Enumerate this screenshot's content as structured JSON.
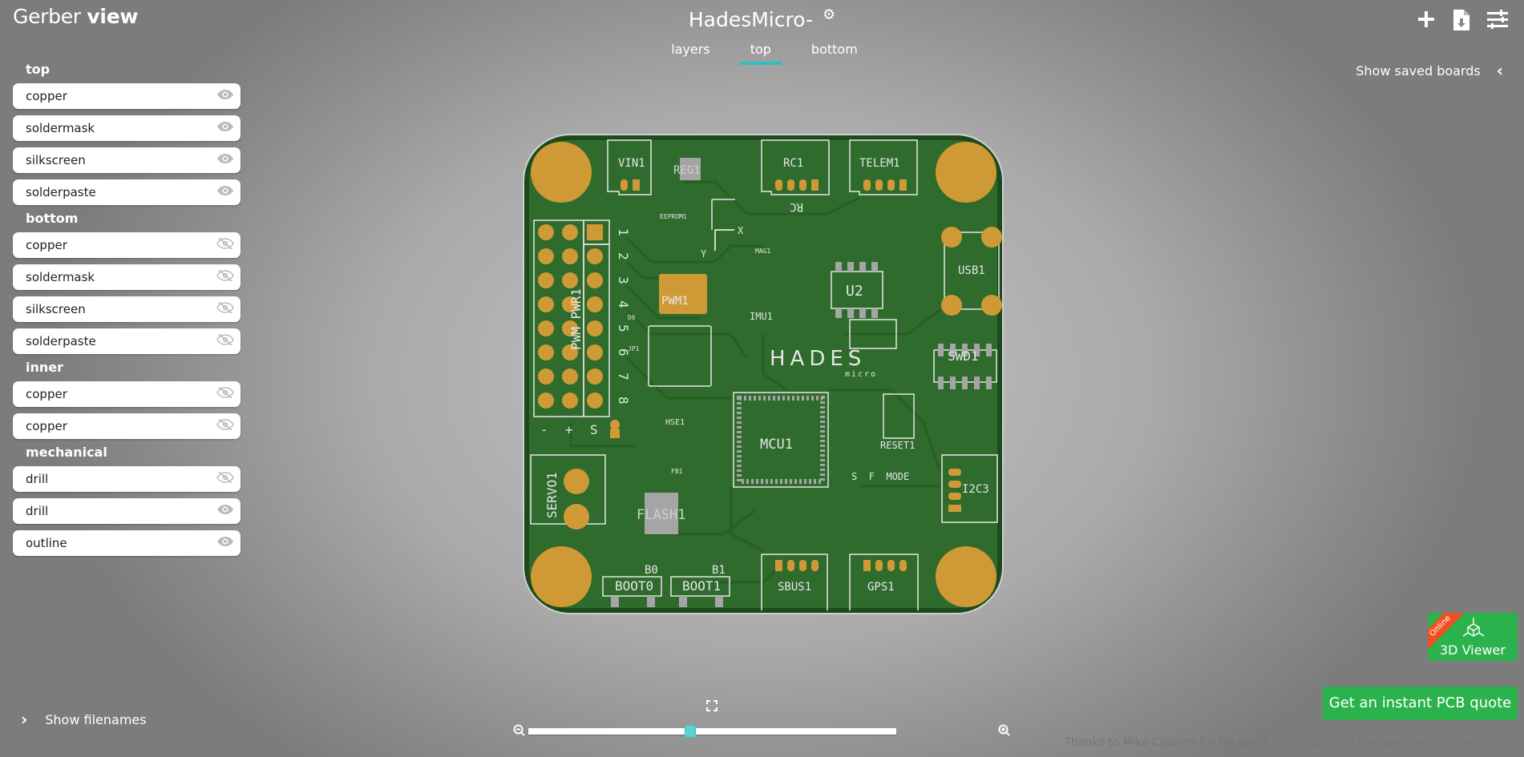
{
  "header": {
    "title_regular": "Gerber",
    "title_bold": "view",
    "board_name": "HadesMicro-",
    "tabs": [
      {
        "label": "layers",
        "active": false
      },
      {
        "label": "top",
        "active": true
      },
      {
        "label": "bottom",
        "active": false
      }
    ],
    "saved_boards": "Show saved boards",
    "icons": [
      "plus-icon",
      "download-file-icon",
      "sliders-icon",
      "gear-icon"
    ]
  },
  "sidebar": {
    "sections": [
      {
        "title": "top",
        "layers": [
          {
            "label": "copper",
            "visible": true
          },
          {
            "label": "soldermask",
            "visible": true
          },
          {
            "label": "silkscreen",
            "visible": true
          },
          {
            "label": "solderpaste",
            "visible": true
          }
        ]
      },
      {
        "title": "bottom",
        "layers": [
          {
            "label": "copper",
            "visible": false
          },
          {
            "label": "soldermask",
            "visible": false
          },
          {
            "label": "silkscreen",
            "visible": false
          },
          {
            "label": "solderpaste",
            "visible": false
          }
        ]
      },
      {
        "title": "inner",
        "layers": [
          {
            "label": "copper",
            "visible": false
          },
          {
            "label": "copper",
            "visible": false
          }
        ]
      },
      {
        "title": "mechanical",
        "layers": [
          {
            "label": "drill",
            "visible": false
          },
          {
            "label": "drill",
            "visible": true
          },
          {
            "label": "outline",
            "visible": true
          }
        ]
      }
    ],
    "show_filenames": "Show filenames"
  },
  "pcb": {
    "labels": [
      "VIN1",
      "REG1",
      "RC1",
      "TELEM1",
      "RC",
      "PWM1",
      "PWM_PWR1",
      "U2",
      "USB1",
      "IMU1",
      "HADES",
      "micro",
      "SWD1",
      "MCU1",
      "RESET1",
      "I2C3",
      "SERVO1",
      "FLASH1",
      "HSE1",
      "S  F  MODE",
      "B0",
      "B1",
      "BOOT0",
      "BOOT1",
      "SBUS1",
      "GPS1",
      "EEPROM1",
      "MAG1",
      "1",
      "2",
      "3",
      "4",
      "5",
      "6",
      "7",
      "8",
      "-",
      "+",
      "S",
      "X",
      "Y",
      "D6",
      "JP1",
      "FB1"
    ],
    "colors": {
      "board": "#2e6b2d",
      "edge": "#1d4a1c",
      "pad": "#cf9a35",
      "silk": "#e6e6e6",
      "outline": "#d0d0d0"
    }
  },
  "zoom": {
    "level": 0.44,
    "icons": [
      "zoom-out-icon",
      "zoom-in-icon",
      "fullscreen-icon"
    ]
  },
  "viewer3d": {
    "badge": "Online",
    "label": "3D Viewer"
  },
  "quote_button": "Get an instant PCB quote",
  "credits": "Thanks to Mike Cousins for his great contribution to the open source community.",
  "accent": "#2dc0c2",
  "button_green": "#2bb24c"
}
